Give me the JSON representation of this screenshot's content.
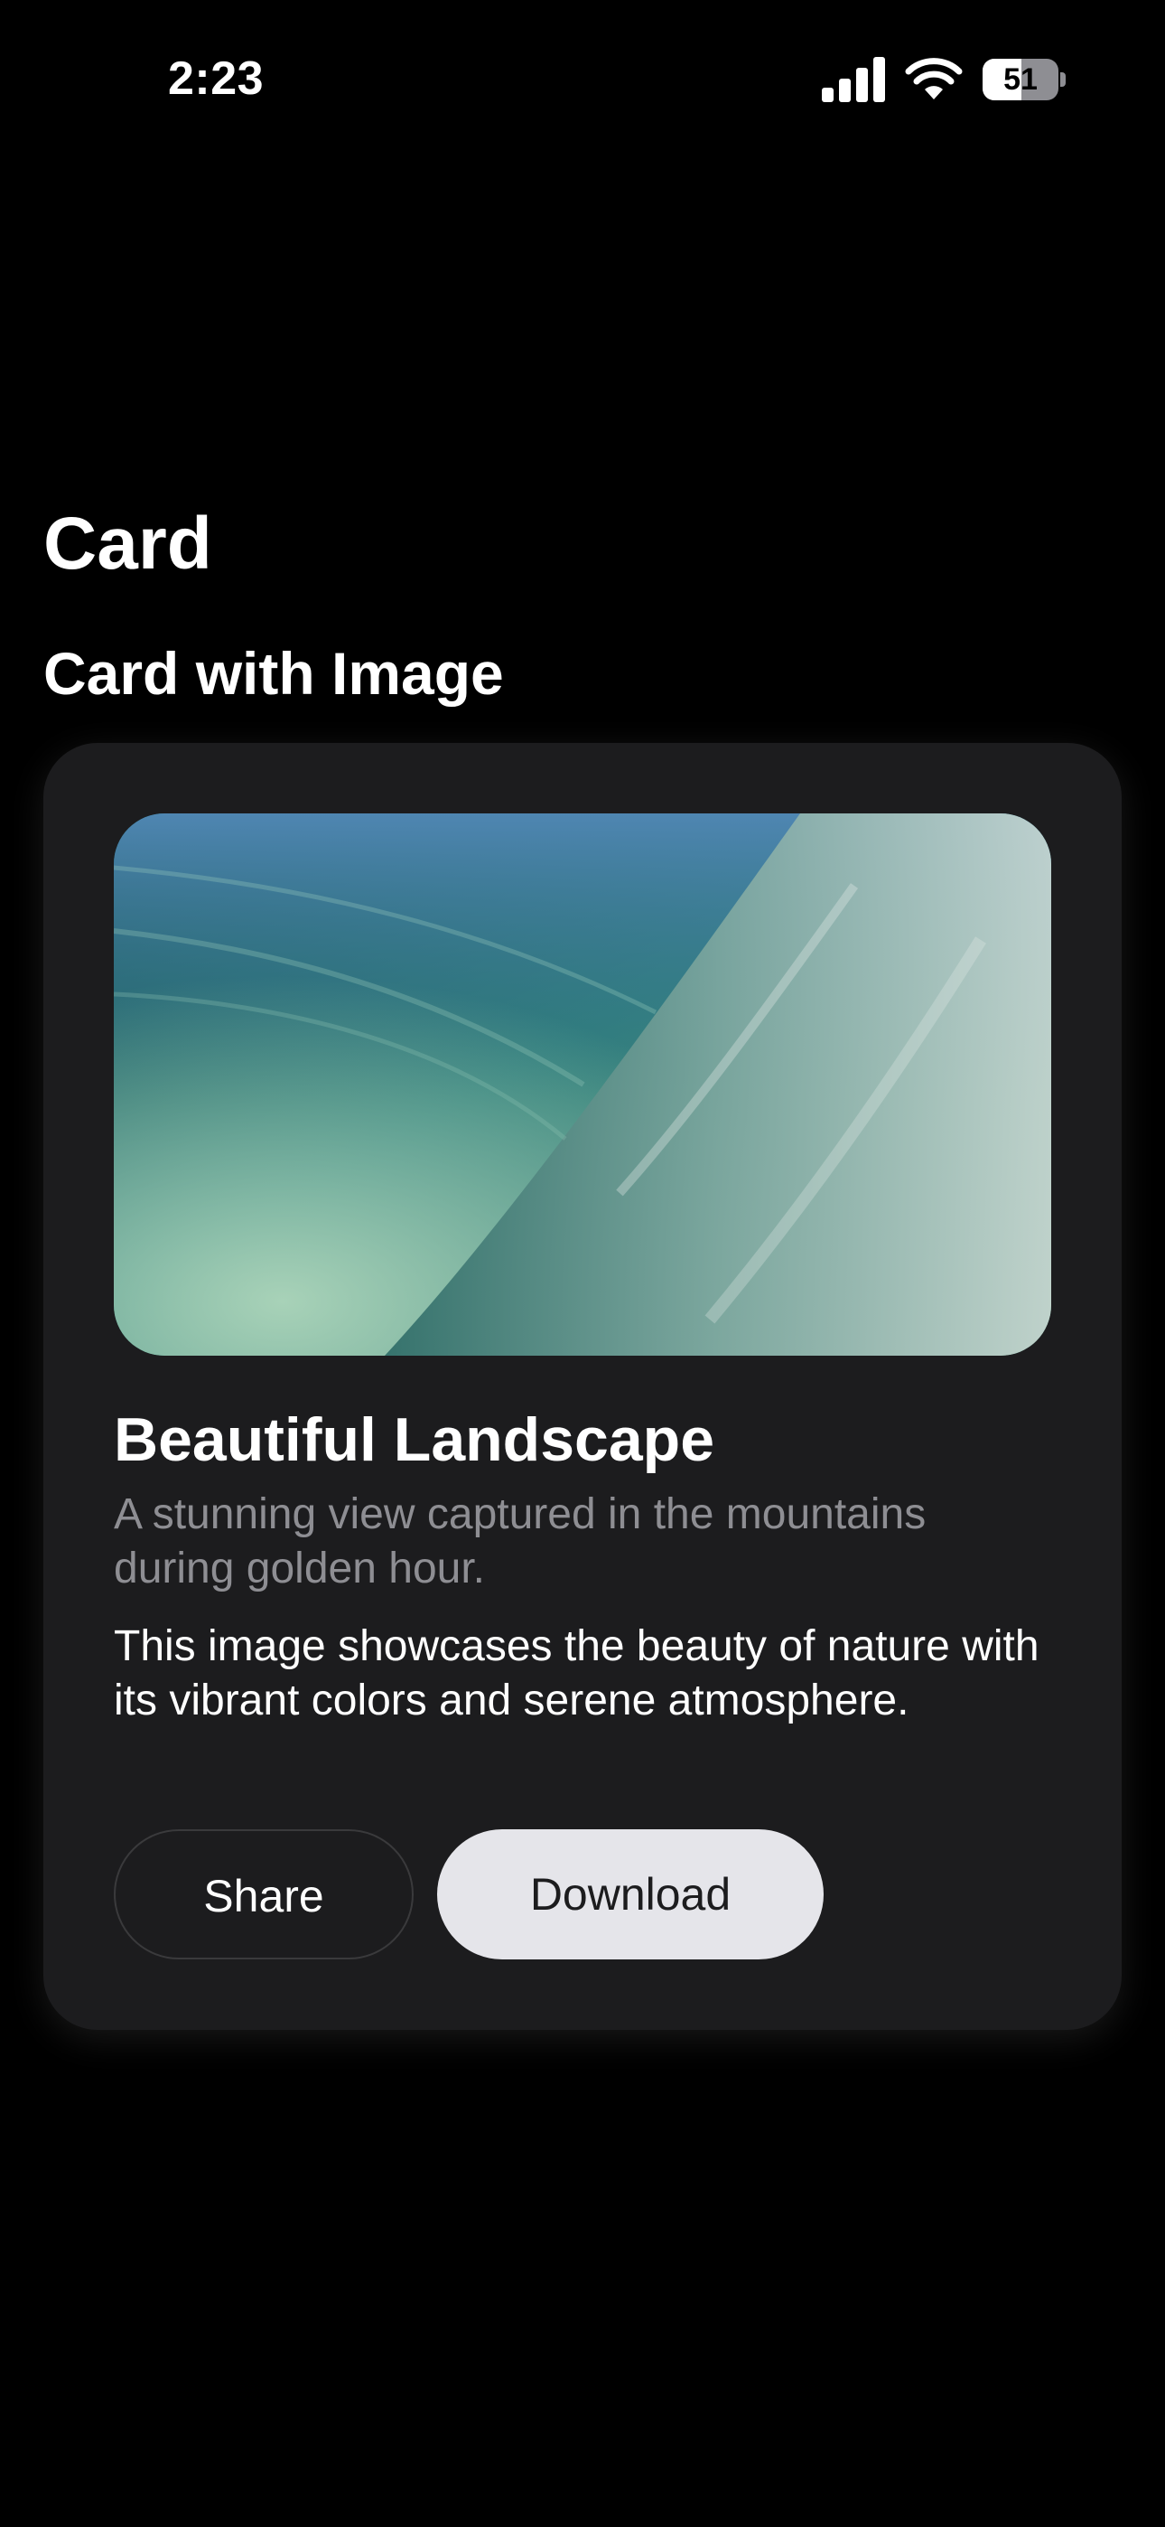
{
  "status_bar": {
    "time": "2:23",
    "battery_level": "51",
    "battery_fraction": 0.51,
    "icons": [
      "cellular-signal-icon",
      "wifi-icon",
      "battery-icon"
    ]
  },
  "page": {
    "title": "Card",
    "section_title": "Card with Image"
  },
  "card": {
    "image": "ocean-wave-photo",
    "title": "Beautiful Landscape",
    "subtitle": "A stunning view captured in the mountains during golden hour.",
    "body": "This image showcases the beauty of nature with its vibrant colors and serene atmosphere.",
    "actions": {
      "share_label": "Share",
      "download_label": "Download"
    }
  },
  "colors": {
    "background": "#000000",
    "card_background": "#1c1c1e",
    "secondary_text": "#8e8e93",
    "primary_button_bg": "#e5e5ea",
    "outline_button_border": "#3a3a3c"
  }
}
